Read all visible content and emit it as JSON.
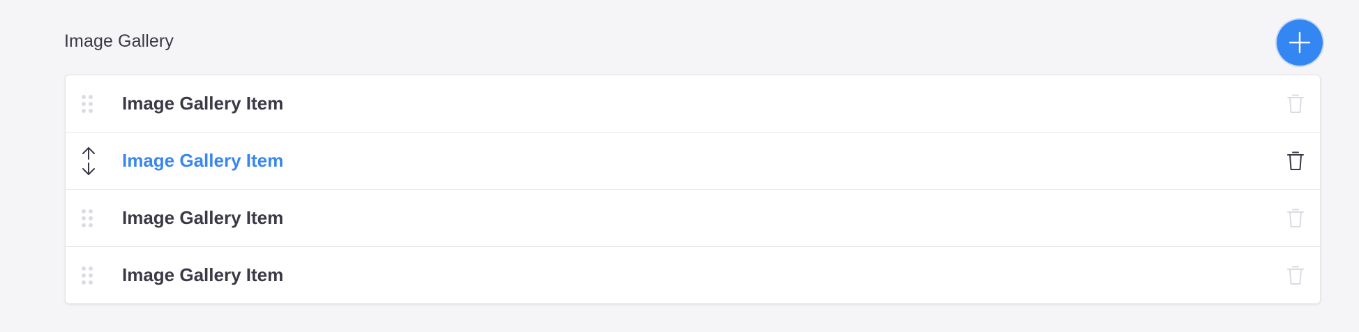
{
  "section": {
    "title": "Image Gallery"
  },
  "add_button": {
    "icon": "plus-icon",
    "color": "#3486f2"
  },
  "items": [
    {
      "label": "Image Gallery Item",
      "state": "default",
      "drag_icon": "drag-handle-icon"
    },
    {
      "label": "Image Gallery Item",
      "state": "active",
      "drag_icon": "move-vertical-icon"
    },
    {
      "label": "Image Gallery Item",
      "state": "default",
      "drag_icon": "drag-handle-icon"
    },
    {
      "label": "Image Gallery Item",
      "state": "default",
      "drag_icon": "drag-handle-icon"
    }
  ],
  "colors": {
    "accent": "#3a86ef",
    "text": "#3a3946",
    "muted_icon": "#dcdbe4",
    "background": "#f5f5f7"
  }
}
